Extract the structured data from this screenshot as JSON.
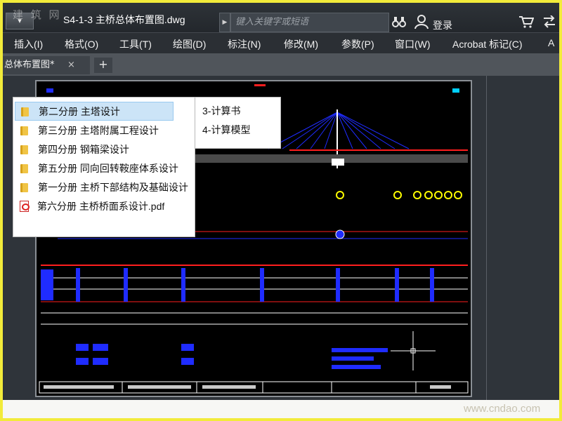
{
  "watermark_logo": "建 筑 网",
  "titlebar": {
    "quick_access": "▾",
    "document_title": "S4-1-3 主桥总体布置图.dwg",
    "search_placeholder": "键入关键字或短语",
    "login_label": "登录",
    "icons": [
      "binoculars-icon",
      "user-icon",
      "cart-icon",
      "exchange-icon"
    ]
  },
  "menu": {
    "items": [
      "插入(I)",
      "格式(O)",
      "工具(T)",
      "绘图(D)",
      "标注(N)",
      "修改(M)",
      "参数(P)",
      "窗口(W)",
      "Acrobat 标记(C)",
      "A"
    ]
  },
  "tabs": {
    "active_label": "总体布置图*",
    "close_glyph": "×",
    "add_glyph": "+"
  },
  "popup": {
    "left_items": [
      {
        "label": "第二分册 主塔设计",
        "icon": "folder-icon",
        "selected": true
      },
      {
        "label": "第三分册 主塔附属工程设计",
        "icon": "folder-icon",
        "selected": false
      },
      {
        "label": "第四分册 钢箱梁设计",
        "icon": "folder-icon",
        "selected": false
      },
      {
        "label": "第五分册 同向回转鞍座体系设计",
        "icon": "folder-icon",
        "selected": false
      },
      {
        "label": "第一分册 主桥下部结构及基础设计",
        "icon": "folder-icon",
        "selected": false
      },
      {
        "label": "第六分册 主桥桥面系设计.pdf",
        "icon": "pdf-icon",
        "selected": false
      }
    ],
    "right_items": [
      {
        "label": "3-计算书",
        "icon": "folder-icon"
      },
      {
        "label": "4-计算模型",
        "icon": "folder-icon"
      }
    ]
  },
  "status": {
    "site_watermark": "www.cndao.com"
  },
  "colors": {
    "frame_border": "#f2eb3a",
    "titlebar": "#2e3338",
    "menubar": "#2b2f34",
    "canvas": "#000000",
    "cad_blue": "#1f2cff",
    "cad_red": "#ff1e1e",
    "cad_yellow": "#ffff00",
    "selection": "#cce4f7"
  }
}
